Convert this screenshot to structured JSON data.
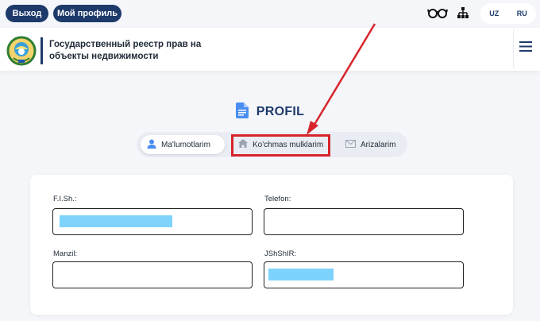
{
  "topbar": {
    "logout_label": "Выход",
    "profile_label": "Мой профиль",
    "icons": [
      "glasses-icon",
      "sitemap-icon"
    ],
    "languages": [
      "UZ",
      "RU"
    ]
  },
  "header": {
    "site_title": "Государственный реестр прав на объекты недвижимости",
    "logo": "uzbekistan-emblem-icon",
    "menu_icon": "hamburger-menu-icon"
  },
  "page": {
    "title": "PROFIL",
    "title_icon": "document-icon"
  },
  "tabs": [
    {
      "label": "Ma'lumotlarim",
      "icon": "user-icon",
      "active": true
    },
    {
      "label": "Ko'chmas mulklarim",
      "icon": "house-icon",
      "active": false
    },
    {
      "label": "Arizalarim",
      "icon": "envelope-icon",
      "active": false
    }
  ],
  "annotation": {
    "color": "#d7242b",
    "target": "Ko'chmas mulklarim"
  },
  "form": {
    "fields": [
      {
        "label": "F.I.Sh.:",
        "value": "",
        "redacted": true
      },
      {
        "label": "Telefon:",
        "value": "",
        "redacted": false
      },
      {
        "label": "Manzil:",
        "value": "",
        "redacted": false
      },
      {
        "label": "JShShIR:",
        "value": "",
        "redacted": true
      }
    ]
  },
  "colors": {
    "primary": "#1d3a6b",
    "redaction": "#7dd3fc",
    "background": "#f4f6fa"
  }
}
